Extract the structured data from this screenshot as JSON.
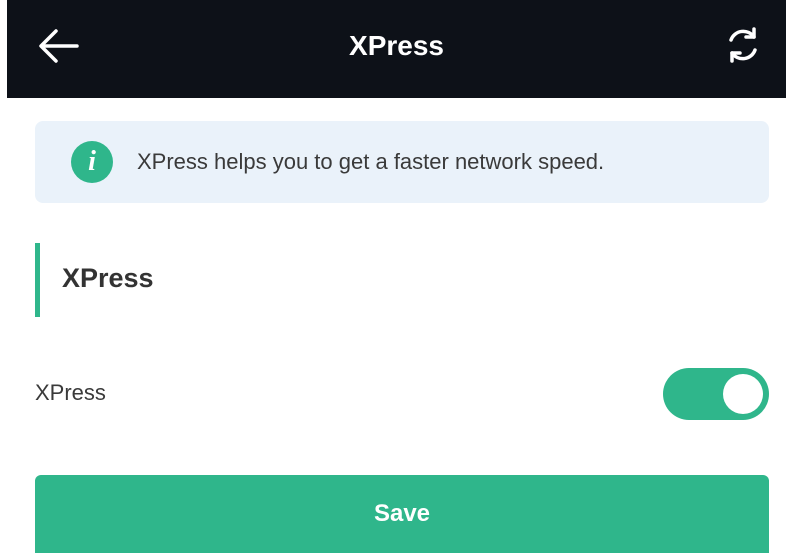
{
  "header": {
    "title": "XPress",
    "back_icon": "arrow-left-icon",
    "refresh_icon": "refresh-icon"
  },
  "banner": {
    "icon": "info-icon",
    "icon_glyph": "i",
    "text": "XPress helps you to get a faster network speed."
  },
  "section": {
    "title": "XPress"
  },
  "settings": {
    "xpress_label": "XPress",
    "xpress_enabled": true
  },
  "actions": {
    "save_label": "Save"
  },
  "colors": {
    "accent": "#2fb68b",
    "header_bg": "#0d1118",
    "banner_bg": "#eaf2fa"
  }
}
